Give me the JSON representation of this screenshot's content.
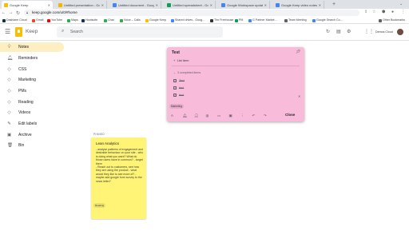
{
  "browser": {
    "tabs": [
      {
        "title": "Google Keep",
        "color": "#fbbc04",
        "active": true
      },
      {
        "title": "Untitled presentation - Google Slid…",
        "color": "#f4b400"
      },
      {
        "title": "Untitled document - Google Docs",
        "color": "#4285f4"
      },
      {
        "title": "Untitled spreadsheet - Google She…",
        "color": "#0f9d58"
      },
      {
        "title": "Google Workspace updates: Ne…",
        "color": "#4285f4"
      },
      {
        "title": "Google Keep video notes - Sto…",
        "color": "#4285f4"
      }
    ],
    "new_tab": "+",
    "url": "keep.google.com/u/0/#home",
    "bookmarks": [
      {
        "label": "Dashlane Cloud",
        "color": "#0e353d"
      },
      {
        "label": "Gmail",
        "color": "#ea4335"
      },
      {
        "label": "YouTube",
        "color": "#ff0000"
      },
      {
        "label": "Maps",
        "color": "#34a853"
      },
      {
        "label": "Hootsuite",
        "color": "#143059"
      },
      {
        "label": "Chat",
        "color": "#34a853"
      },
      {
        "label": "Voice – Calls",
        "color": "#34a853"
      },
      {
        "label": "Google Keep",
        "color": "#fbbc04"
      },
      {
        "label": "Shared drives - Goog…",
        "color": "#4285f4"
      },
      {
        "label": "The Freehouse",
        "color": "#333333"
      },
      {
        "label": "PM",
        "color": "#0f9d58"
      },
      {
        "label": "G Partner Market…",
        "color": "#4285f4"
      },
      {
        "label": "Team Meeting",
        "color": "#5f6368"
      },
      {
        "label": "Google Search Co…",
        "color": "#4285f4"
      },
      {
        "label": "Other Bookmarks",
        "color": "#5f6368"
      }
    ]
  },
  "header": {
    "app_name": "Keep",
    "search_placeholder": "Search",
    "account_label": "Demos Cloud"
  },
  "sidebar": {
    "items": [
      {
        "label": "Notes",
        "icon": "lightbulb-icon",
        "active": true
      },
      {
        "label": "Reminders",
        "icon": "bell-icon"
      },
      {
        "label": "CSS",
        "icon": "label-icon"
      },
      {
        "label": "Marketing",
        "icon": "label-icon"
      },
      {
        "label": "PMs",
        "icon": "label-icon"
      },
      {
        "label": "Reading",
        "icon": "label-icon"
      },
      {
        "label": "Videos",
        "icon": "label-icon"
      },
      {
        "label": "Edit labels",
        "icon": "pencil-icon"
      },
      {
        "label": "Archive",
        "icon": "archive-icon"
      },
      {
        "label": "Bin",
        "icon": "trash-icon"
      }
    ]
  },
  "note": {
    "title": "Test",
    "list_item_prompt": "List item",
    "completed_label": "3 completed items",
    "completed_items": [
      "Test",
      "test",
      "test"
    ],
    "label": "Marketing",
    "close_label": "Close",
    "color": "#f8bbd9"
  },
  "pinned": {
    "section_label": "PINNED",
    "card": {
      "title": "Lean Analytics",
      "body": "- analyse patterns of engagement and desirable behaviour on your site - who is doing what you want? What do those users have in common? - target them\n- Reach out to customers, see how they are using the product - what would they like to see more of? - maybe add google form survey to the news letter?",
      "label": "Reading",
      "color": "#fff475"
    }
  }
}
